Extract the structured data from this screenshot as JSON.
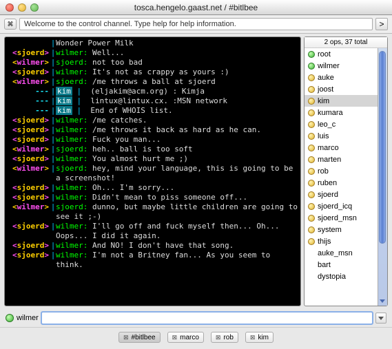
{
  "window": {
    "title": "tosca.hengelo.gaast.net / #bitlbee"
  },
  "toolbar": {
    "welcome": "Welcome to the control channel. Type help for help information.",
    "go": ">"
  },
  "chat": [
    {
      "nick": "",
      "nclass": "",
      "msg": "Wonder Power Milk"
    },
    {
      "nick": "sjoerd",
      "nclass": "c-yellow",
      "sp": "wilmer:",
      "msg": " Well..."
    },
    {
      "nick": "wilmer",
      "nclass": "c-magenta",
      "sp": "sjoerd:",
      "msg": " not too bad"
    },
    {
      "nick": "sjoerd",
      "nclass": "c-yellow",
      "sp": "wilmer:",
      "msg": " It's not as crappy as yours :)"
    },
    {
      "nick": "wilmer",
      "nclass": "c-magenta",
      "sp": "sjoerd:",
      "msg": " /me throws a ball at sjoerd"
    },
    {
      "nick": "---",
      "nclass": "c-cyan2",
      "kim": true,
      "msg": " (eljakim@acm.org) : Kimja"
    },
    {
      "nick": "---",
      "nclass": "c-cyan2",
      "kim": true,
      "msg": " lintux@lintux.cx. :MSN network"
    },
    {
      "nick": "---",
      "nclass": "c-cyan2",
      "kim": true,
      "msg": " End of WHOIS list."
    },
    {
      "nick": "sjoerd",
      "nclass": "c-yellow",
      "sp": "wilmer:",
      "msg": " /me catches."
    },
    {
      "nick": "sjoerd",
      "nclass": "c-yellow",
      "sp": "wilmer:",
      "msg": " /me throws it back as hard as he can."
    },
    {
      "nick": "sjoerd",
      "nclass": "c-yellow",
      "sp": "wilmer:",
      "msg": " Fuck you man..."
    },
    {
      "nick": "wilmer",
      "nclass": "c-magenta",
      "sp": "sjoerd:",
      "msg": " heh.. ball is too soft"
    },
    {
      "nick": "sjoerd",
      "nclass": "c-yellow",
      "sp": "wilmer:",
      "msg": " You almost hurt me ;)"
    },
    {
      "nick": "wilmer",
      "nclass": "c-magenta",
      "sp": "sjoerd:",
      "msg": " hey, mind your language, this is going to be a screenshot!"
    },
    {
      "nick": "sjoerd",
      "nclass": "c-yellow",
      "sp": "wilmer:",
      "msg": " Oh... I'm sorry..."
    },
    {
      "nick": "sjoerd",
      "nclass": "c-yellow",
      "sp": "wilmer:",
      "msg": " Didn't mean to piss someone off..."
    },
    {
      "nick": "wilmer",
      "nclass": "c-magenta",
      "sp": "sjoerd:",
      "msg": " dunno, but maybe little children are going to see it ;-)"
    },
    {
      "nick": "sjoerd",
      "nclass": "c-yellow",
      "sp": "wilmer:",
      "msg": " I'll go off and fuck myself then... Oh... Oops... I did it again."
    },
    {
      "nick": "sjoerd",
      "nclass": "c-yellow",
      "sp": "wilmer:",
      "msg": " And NO! I don't have that song."
    },
    {
      "nick": "sjoerd",
      "nclass": "c-yellow",
      "sp": "wilmer:",
      "msg": " I'm not a Britney fan... As you seem to think."
    }
  ],
  "users": {
    "summary": "2 ops, 37 total",
    "items": [
      {
        "name": "root",
        "dot": "green",
        "sel": false
      },
      {
        "name": "wilmer",
        "dot": "green",
        "sel": false
      },
      {
        "name": "auke",
        "dot": "yellow",
        "sel": false
      },
      {
        "name": "joost",
        "dot": "yellow",
        "sel": false
      },
      {
        "name": "kim",
        "dot": "yellow",
        "sel": true
      },
      {
        "name": "kumara",
        "dot": "yellow",
        "sel": false
      },
      {
        "name": "leo_c",
        "dot": "yellow",
        "sel": false
      },
      {
        "name": "luis",
        "dot": "yellow",
        "sel": false
      },
      {
        "name": "marco",
        "dot": "yellow",
        "sel": false
      },
      {
        "name": "marten",
        "dot": "yellow",
        "sel": false
      },
      {
        "name": "rob",
        "dot": "yellow",
        "sel": false
      },
      {
        "name": "ruben",
        "dot": "yellow",
        "sel": false
      },
      {
        "name": "sjoerd",
        "dot": "yellow",
        "sel": false
      },
      {
        "name": "sjoerd_icq",
        "dot": "yellow",
        "sel": false
      },
      {
        "name": "sjoerd_msn",
        "dot": "yellow",
        "sel": false
      },
      {
        "name": "system",
        "dot": "yellow",
        "sel": false
      },
      {
        "name": "thijs",
        "dot": "yellow",
        "sel": false
      },
      {
        "name": "auke_msn",
        "dot": "none",
        "sel": false
      },
      {
        "name": "bart",
        "dot": "none",
        "sel": false
      },
      {
        "name": "dystopia",
        "dot": "none",
        "sel": false
      }
    ]
  },
  "compose": {
    "nick": "wilmer",
    "value": ""
  },
  "tabs": [
    {
      "label": "#bitlbee",
      "active": true
    },
    {
      "label": "marco",
      "active": false
    },
    {
      "label": "rob",
      "active": false
    },
    {
      "label": "kim",
      "active": false
    }
  ]
}
